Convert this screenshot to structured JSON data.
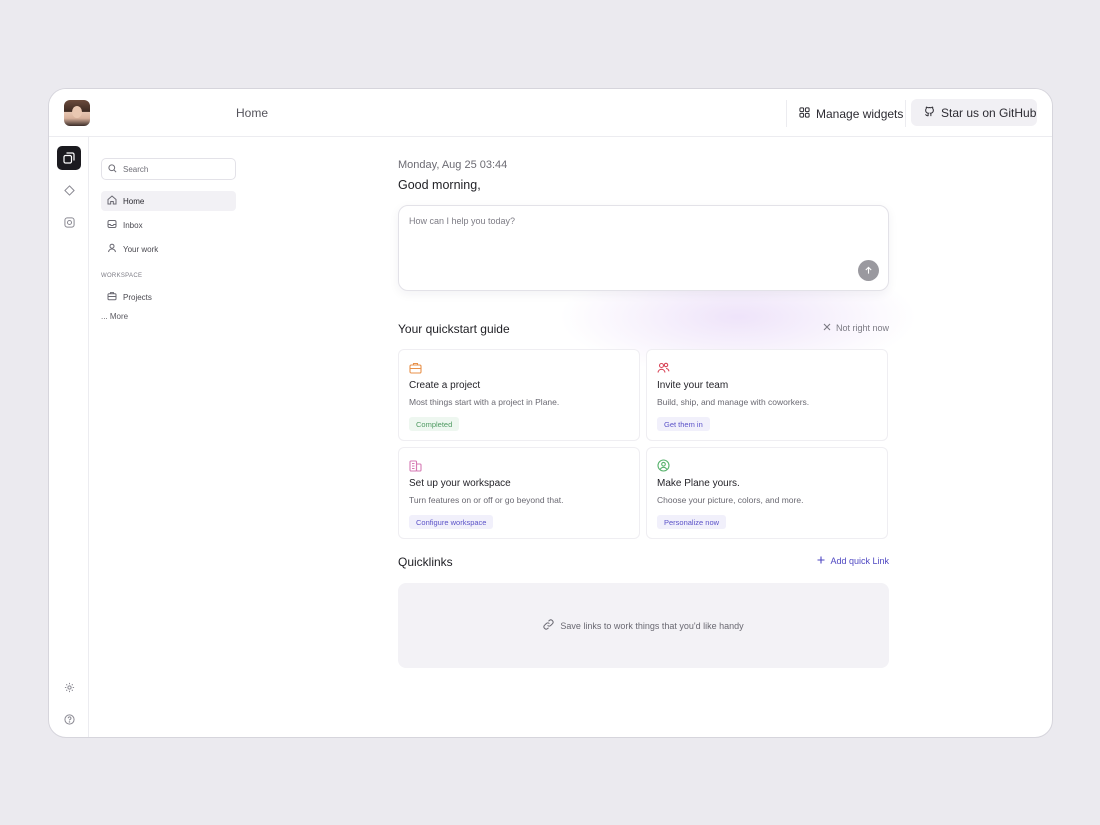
{
  "topbar": {
    "breadcrumb": "Home",
    "manage_widgets_label": "Manage widgets",
    "github_label": "Star us on GitHub"
  },
  "sidebar": {
    "search_placeholder": "Search",
    "items": [
      {
        "label": "Home",
        "icon": "home-icon",
        "selected": true
      },
      {
        "label": "Inbox",
        "icon": "inbox-icon"
      },
      {
        "label": "Your work",
        "icon": "user-icon"
      }
    ],
    "workspace_label": "WORKSPACE",
    "workspace_items": [
      {
        "label": "Projects",
        "icon": "briefcase-icon"
      }
    ],
    "more_label": "... More"
  },
  "main": {
    "date": "Monday, Aug 25 03:44",
    "greeting": "Good morning,",
    "ask_placeholder": "How can I help you today?",
    "quickstart": {
      "title": "Your quickstart guide",
      "dismiss": "Not right now",
      "cards": [
        {
          "title": "Create a project",
          "desc": "Most things start with a project in Plane.",
          "action": "Completed",
          "icon": "briefcase-icon",
          "icon_color": "#e8914a"
        },
        {
          "title": "Invite your team",
          "desc": "Build, ship, and manage with coworkers.",
          "action": "Get them in",
          "icon": "users-icon",
          "icon_color": "#d9475a"
        },
        {
          "title": "Set up your workspace",
          "desc": "Turn features on or off or go beyond that.",
          "action": "Configure workspace",
          "icon": "building-icon",
          "icon_color": "#d67ab4"
        },
        {
          "title": "Make Plane yours.",
          "desc": "Choose your picture, colors, and more.",
          "action": "Personalize now",
          "icon": "user-circle-icon",
          "icon_color": "#58b36d"
        }
      ]
    },
    "quicklinks": {
      "title": "Quicklinks",
      "add_label": "Add quick Link",
      "empty_text": "Save links to work things that you'd like handy"
    }
  }
}
